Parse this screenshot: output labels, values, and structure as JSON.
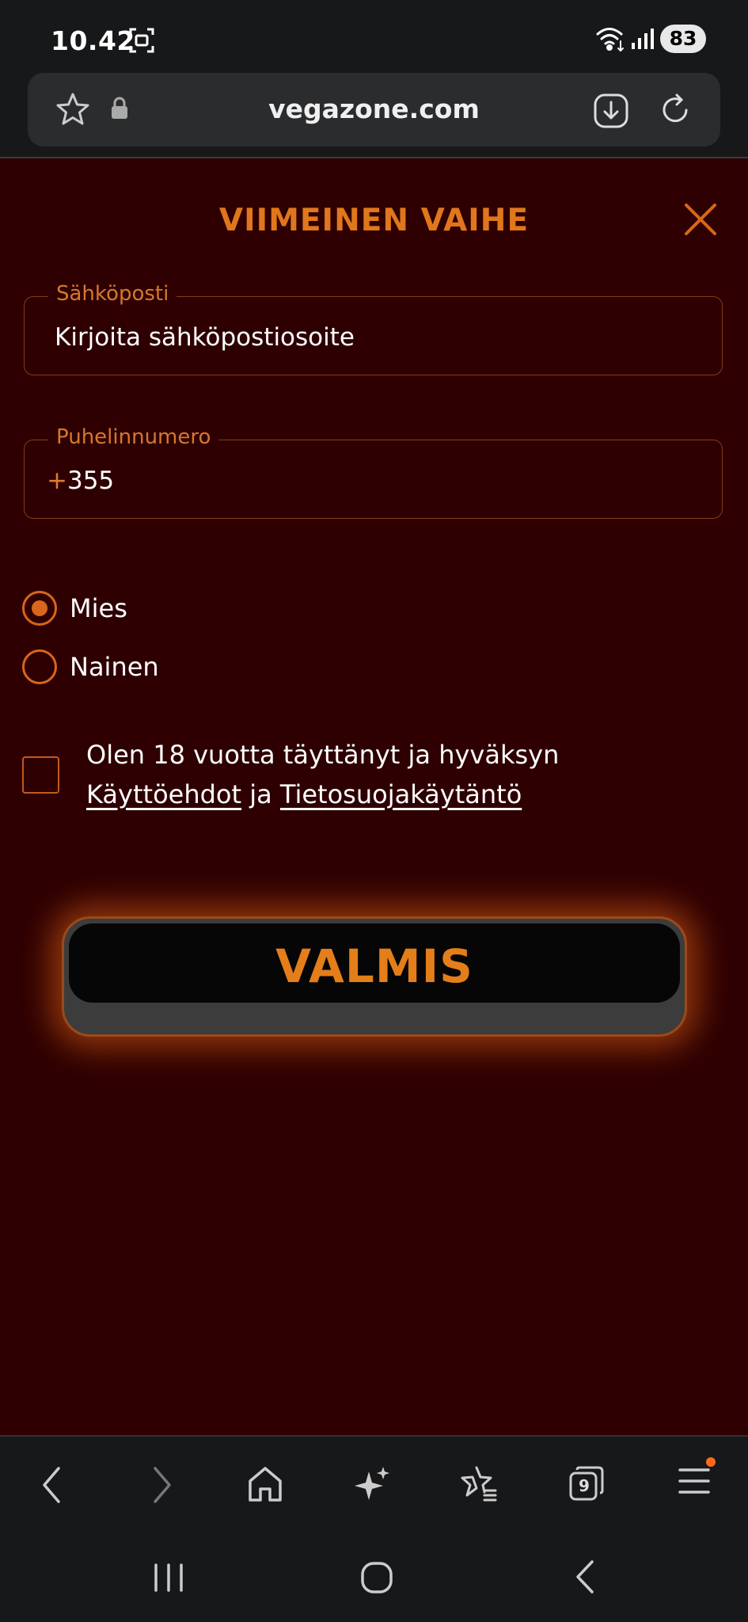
{
  "status_bar": {
    "time": "10.42",
    "battery": "83"
  },
  "browser": {
    "url": "vegazone.com",
    "tabs_count": "9"
  },
  "form": {
    "title": "VIIMEINEN VAIHE",
    "email": {
      "label": "Sähköposti",
      "placeholder": "Kirjoita sähköpostiosoite"
    },
    "phone": {
      "label": "Puhelinnumero",
      "plus": "+",
      "code": "355"
    },
    "gender": [
      {
        "label": "Mies",
        "checked": true
      },
      {
        "label": "Nainen",
        "checked": false
      }
    ],
    "terms": {
      "text": "Olen 18 vuotta täyttänyt ja hyväksyn",
      "link1": "Käyttöehdot",
      "joiner": " ja ",
      "link2": "Tietosuojakäytäntö"
    },
    "submit": "VALMIS"
  },
  "colors": {
    "background": "#2e0002",
    "accent": "#e0771c"
  },
  "icons": [
    "screenshot-icon",
    "wifi-icon",
    "signal-icon",
    "star-icon",
    "lock-icon",
    "download-icon",
    "reload-icon",
    "close-icon",
    "back-icon",
    "forward-icon",
    "home-icon",
    "sparkle-icon",
    "bookmarks-icon",
    "tabs-icon",
    "menu-icon",
    "recents-icon",
    "home-circle-icon",
    "system-back-icon"
  ]
}
